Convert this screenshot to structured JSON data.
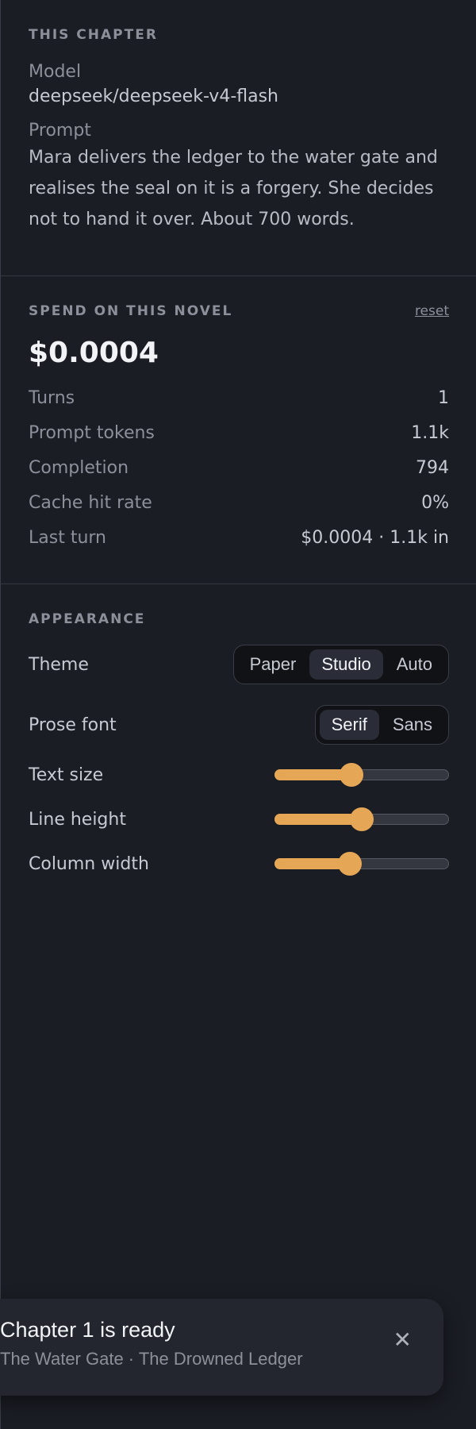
{
  "chapter": {
    "heading": "THIS CHAPTER",
    "model_label": "Model",
    "model_value": "deepseek/deepseek-v4-flash",
    "prompt_label": "Prompt",
    "prompt_lines": [
      "Mara delivers the ledger to the water gate and",
      "realises the seal on it is a forgery. She decides",
      "not to hand it over. About 700 words."
    ]
  },
  "spend": {
    "heading": "SPEND ON THIS NOVEL",
    "reset_label": "reset",
    "total": "$0.0004",
    "stats": [
      {
        "label": "Turns",
        "value": "1"
      },
      {
        "label": "Prompt tokens",
        "value": "1.1k"
      },
      {
        "label": "Completion",
        "value": "794"
      },
      {
        "label": "Cache hit rate",
        "value": "0%"
      },
      {
        "label": "Last turn",
        "value": "$0.0004 · 1.1k in"
      }
    ]
  },
  "appearance": {
    "heading": "APPEARANCE",
    "theme_label": "Theme",
    "theme_options": [
      "Paper",
      "Studio",
      "Auto"
    ],
    "theme_selected": "Studio",
    "font_label": "Prose font",
    "font_options": [
      "Serif",
      "Sans"
    ],
    "font_selected": "Serif",
    "sliders": [
      {
        "label": "Text size",
        "value": 0.44
      },
      {
        "label": "Line height",
        "value": 0.5
      },
      {
        "label": "Column width",
        "value": 0.43
      }
    ],
    "accent_color": "#e5a656"
  },
  "toast": {
    "title": "Chapter 1 is ready",
    "subtitle": "The Water Gate · The Drowned Ledger",
    "close_icon": "close-icon"
  }
}
